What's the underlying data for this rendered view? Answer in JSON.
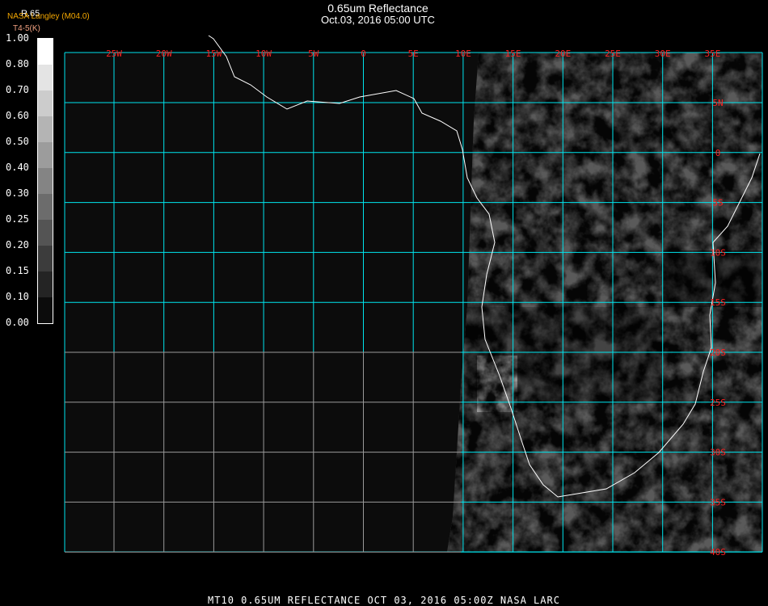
{
  "header": {
    "title": "0.65um Reflectance",
    "datetime": "Oct.03, 2016 05:00 UTC"
  },
  "institution": "NASA Langley (M04.0)",
  "colorbar": {
    "title": "R.65",
    "unit": "T4-5(K)",
    "labels": [
      "1.00",
      "0.80",
      "0.70",
      "0.60",
      "0.50",
      "0.40",
      "0.30",
      "0.25",
      "0.20",
      "0.15",
      "0.10",
      "0.00"
    ],
    "colors": [
      "#ffffff",
      "#e4e4e4",
      "#cccccc",
      "#b4b4b4",
      "#9c9c9c",
      "#848484",
      "#6c6c6c",
      "#545454",
      "#3c3c3c",
      "#242424",
      "#0c0c0c"
    ]
  },
  "map": {
    "lon_labels": [
      "25W",
      "20W",
      "15W",
      "10W",
      "5W",
      "0",
      "5E",
      "10E",
      "15E",
      "20E",
      "25E",
      "30E",
      "35E"
    ],
    "lat_labels": [
      "5N",
      "0",
      "5S",
      "10S",
      "15S",
      "20S",
      "25S",
      "30S",
      "35S",
      "40S"
    ],
    "grid_color": "#00e5ee",
    "label_color": "#ff2020"
  },
  "footer": "MT10  0.65UM REFLECTANCE   OCT 03, 2016 05:00Z   NASA LARC"
}
